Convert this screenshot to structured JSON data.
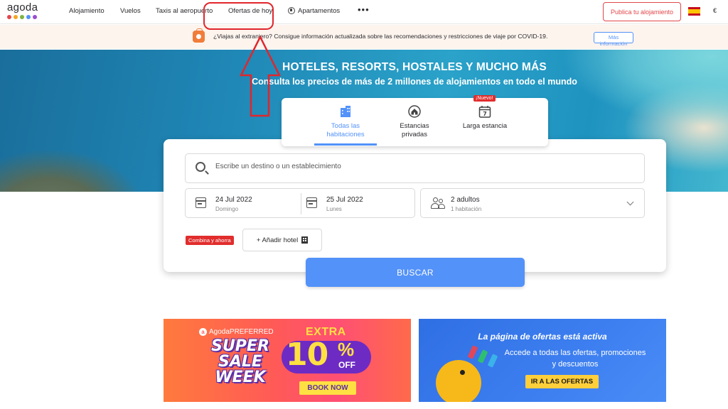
{
  "nav": {
    "logo_text": "agoda",
    "logo_dot_colors": [
      "#e2474b",
      "#f5a623",
      "#7cb342",
      "#5392f9",
      "#9c4dcc"
    ],
    "items": [
      {
        "label": "Alojamiento"
      },
      {
        "label": "Vuelos"
      },
      {
        "label": "Taxis al aeropuerto"
      },
      {
        "label": "Ofertas de hoy"
      },
      {
        "label": "Apartamentos"
      }
    ],
    "more_label": "•••",
    "publish_label": "Publica tu alojamiento",
    "currency": "€"
  },
  "covid": {
    "text": "¿Viajas al extranjero? Consigue información actualizada sobre las recomendaciones y restricciones de viaje por COVID-19.",
    "button_label": "Más información"
  },
  "hero": {
    "title": "HOTELES, RESORTS, HOSTALES Y MUCHO MÁS",
    "subtitle": "Consulta los precios de más de 2 millones de alojamientos en todo el mundo"
  },
  "tabs": [
    {
      "label": "Todas las habitaciones",
      "icon": "buildings-icon",
      "active": true
    },
    {
      "label": "Estancias privadas",
      "icon": "house-icon",
      "active": false
    },
    {
      "label": "Larga estancia",
      "icon": "calendar-7-icon",
      "active": false,
      "badge": "¡Nuevo!"
    }
  ],
  "search": {
    "destination_placeholder": "Escribe un destino o un establecimiento",
    "checkin": {
      "date": "24 Jul 2022",
      "day": "Domingo"
    },
    "checkout": {
      "date": "25 Jul 2022",
      "day": "Lunes"
    },
    "guests": {
      "main": "2 adultos",
      "sub": "1 habitación"
    },
    "combo_badge": "Combina y ahorra",
    "add_hotel_label": "+ Añadir hotel",
    "button_label": "BUSCAR"
  },
  "promo_left": {
    "brand": "AgodaPREFERRED",
    "headline": "SUPER SALE WEEK",
    "extra": "EXTRA",
    "ten": "10",
    "pct": "%",
    "off": "OFF",
    "cta": "BOOK NOW"
  },
  "promo_right": {
    "title": "La página de ofertas está activa",
    "desc": "Accede a todas las ofertas, promociones y descuentos",
    "cta": "IR A LAS OFERTAS"
  },
  "colors": {
    "accent": "#5392f9",
    "brand_red": "#e2474b",
    "annotation_red": "#e0262c"
  }
}
